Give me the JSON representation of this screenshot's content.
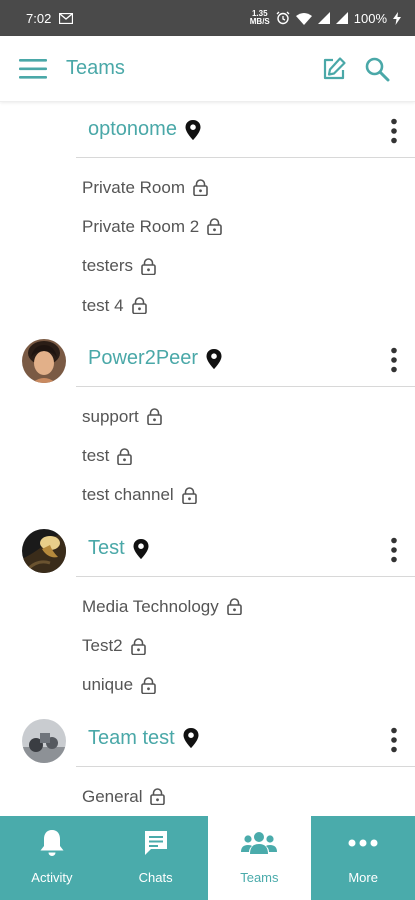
{
  "status_bar": {
    "time": "7:02",
    "net_speed_top": "1.35",
    "net_speed_bottom": "MB/S",
    "battery": "100%"
  },
  "app_bar": {
    "title": "Teams"
  },
  "teams": [
    {
      "name": "optonome",
      "channels": [
        "Private Room",
        "Private Room 2",
        "testers",
        "test 4"
      ]
    },
    {
      "name": "Power2Peer",
      "channels": [
        "support",
        "test",
        "test channel"
      ]
    },
    {
      "name": "Test",
      "channels": [
        "Media Technology",
        "Test2",
        "unique"
      ]
    },
    {
      "name": "Team test",
      "channels": [
        "General"
      ]
    }
  ],
  "bottom_nav": {
    "items": [
      {
        "label": "Activity",
        "icon": "bell-icon"
      },
      {
        "label": "Chats",
        "icon": "chat-icon"
      },
      {
        "label": "Teams",
        "icon": "teams-icon",
        "active": true
      },
      {
        "label": "More",
        "icon": "more-icon"
      }
    ]
  },
  "colors": {
    "accent": "#4aa8a8",
    "nav_background": "#4aabab",
    "status_bar": "#4a4a4a"
  }
}
